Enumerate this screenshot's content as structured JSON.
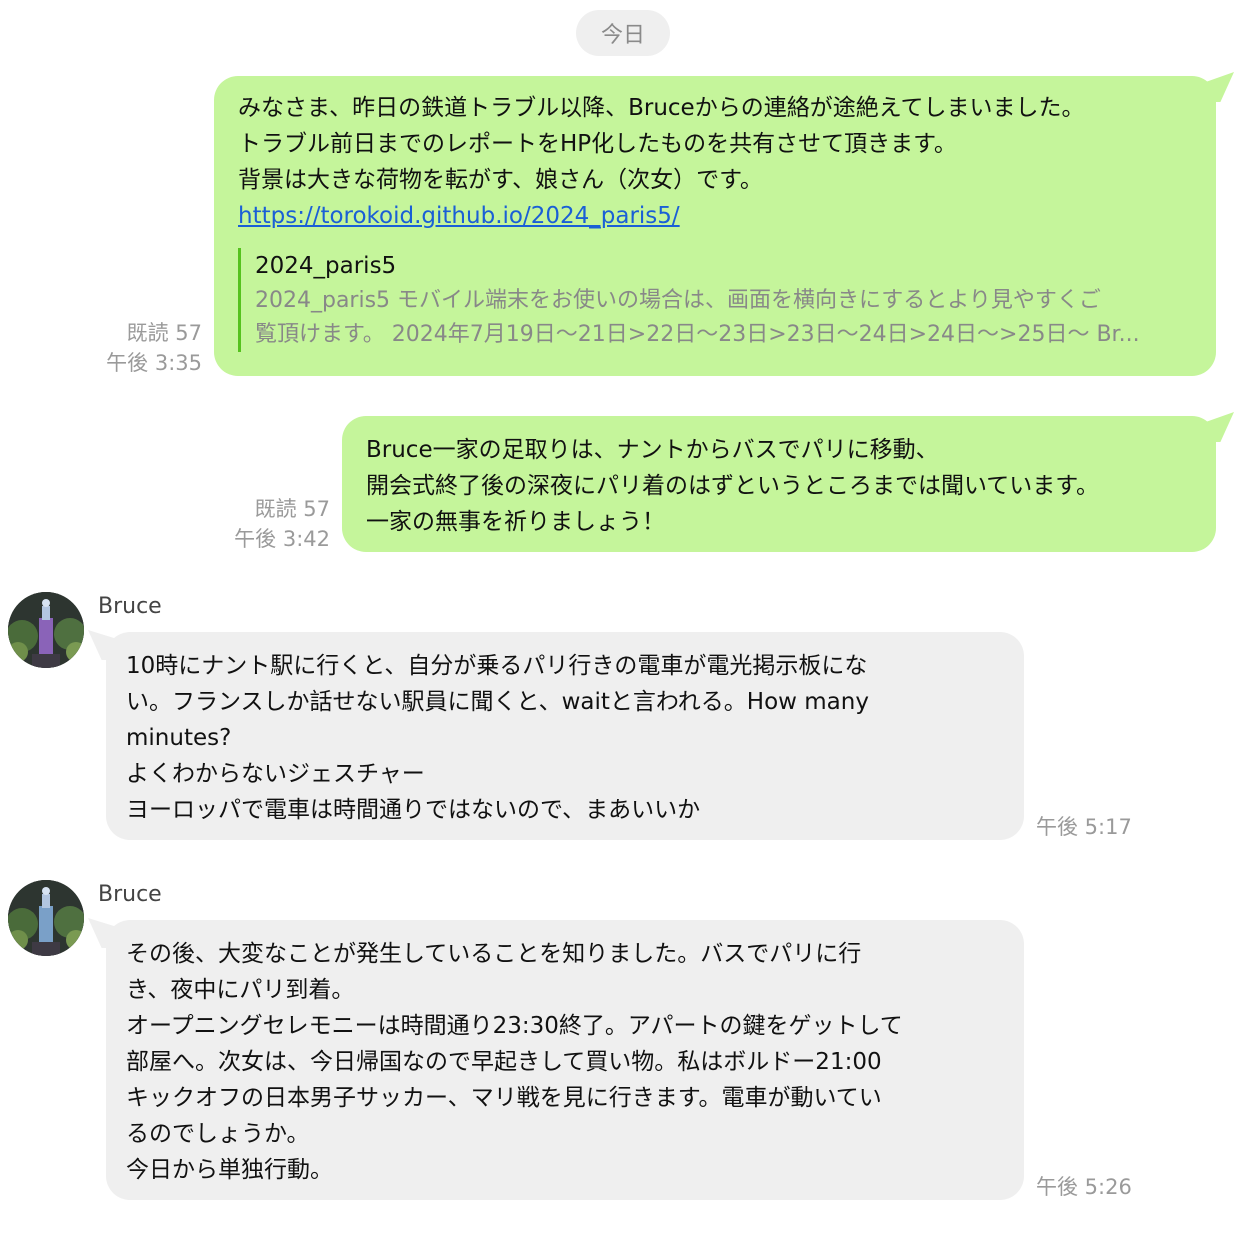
{
  "date_chip": "今日",
  "messages": [
    {
      "read": "既読 57",
      "time": "午後 3:35",
      "lines": [
        "みなさま、昨日の鉄道トラブル以降、Bruceからの連絡が途絶えてしまいました。",
        "トラブル前日までのレポートをHP化したものを共有させて頂きます。",
        "背景は大きな荷物を転がす、娘さん（次女）です。"
      ],
      "link": "https://torokoid.github.io/2024_paris5/",
      "preview": {
        "title": "2024_paris5",
        "desc_lines": [
          "2024_paris5 モバイル端末をお使いの場合は、画面を横向きにするとより見やすくご",
          "覧頂けます。 2024年7月19日〜21日>22日〜23日>23日〜24日>24日〜>25日〜 Br..."
        ]
      }
    },
    {
      "read": "既読 57",
      "time": "午後 3:42",
      "lines": [
        "Bruce一家の足取りは、ナントからバスでパリに移動、",
        "開会式終了後の深夜にパリ着のはずというところまでは聞いています。",
        "一家の無事を祈りましょう！"
      ]
    },
    {
      "sender": "Bruce",
      "time": "午後 5:17",
      "lines": [
        "10時にナント駅に行くと、自分が乗るパリ行きの電車が電光掲示板にな",
        "い。フランスしか話せない駅員に聞くと、waitと言われる。How many",
        "minutes?",
        "よくわからないジェスチャー",
        "ヨーロッパで電車は時間通りではないので、まあいいか"
      ]
    },
    {
      "sender": "Bruce",
      "time": "午後 5:26",
      "lines": [
        "その後、大変なことが発生していることを知りました。バスでパリに行",
        "き、夜中にパリ到着。",
        "オープニングセレモニーは時間通り23:30終了。アパートの鍵をゲットして",
        "部屋へ。次女は、今日帰国なので早起きして買い物。私はボルドー21:00",
        "キックオフの日本男子サッカー、マリ戦を見に行きます。電車が動いてい",
        "るのでしょうか。",
        "今日から単独行動。"
      ]
    }
  ],
  "avatar_icon": "tower-at-night-photo",
  "colors": {
    "outgoing_bubble": "#c5f59b",
    "incoming_bubble": "#efefef",
    "link": "#1a5fd6",
    "preview_bar": "#55c21e"
  }
}
